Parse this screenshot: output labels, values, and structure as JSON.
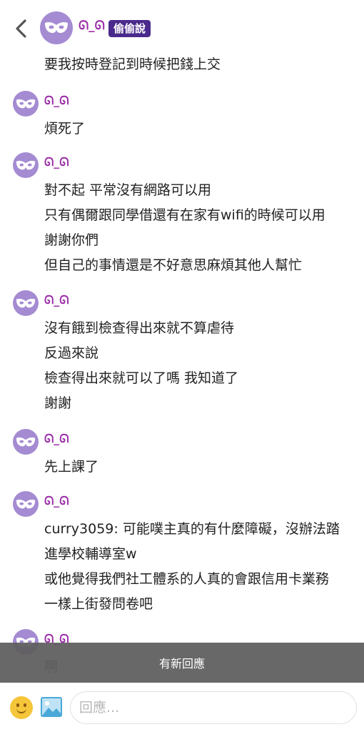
{
  "header": {
    "author_name": "ᘏ_ᘏ",
    "badge": "偷偷說",
    "first_message": "要我按時登記到時候把錢上交"
  },
  "posts": [
    {
      "name": "ᘏ_ᘏ",
      "lines": [
        "煩死了"
      ]
    },
    {
      "name": "ᘏ_ᘏ",
      "lines": [
        "對不起 平常沒有網路可以用",
        "只有偶爾跟同學借還有在家有wifi的時候可以用",
        "謝謝你們",
        "但自己的事情還是不好意思麻煩其他人幫忙"
      ]
    },
    {
      "name": "ᘏ_ᘏ",
      "lines": [
        "沒有餓到檢查得出來就不算虐待",
        "反過來說",
        "檢查得出來就可以了嗎 我知道了",
        "謝謝"
      ]
    },
    {
      "name": "ᘏ_ᘏ",
      "lines": [
        "先上課了"
      ]
    },
    {
      "name": "ᘏ_ᘏ",
      "lines": [
        "curry3059: 可能噗主真的有什麼障礙，沒辦法踏",
        "進學校輔導室w",
        "或他覺得我們社工體系的人真的會跟信用卡業務",
        "一樣上街發問卷吧"
      ]
    },
    {
      "name": "ᘏ_ᘏ",
      "lines": [
        "啊"
      ]
    }
  ],
  "toast": {
    "text": "有新回應"
  },
  "composer": {
    "placeholder": "回應..."
  },
  "colors": {
    "name": "#9b2fa8",
    "badge": "#4a2a8c",
    "avatar": "#a48bd2"
  },
  "icons": {
    "back": "chevron-left-icon",
    "avatar": "mask-icon",
    "emoji": "smiley-icon",
    "image": "image-icon"
  }
}
